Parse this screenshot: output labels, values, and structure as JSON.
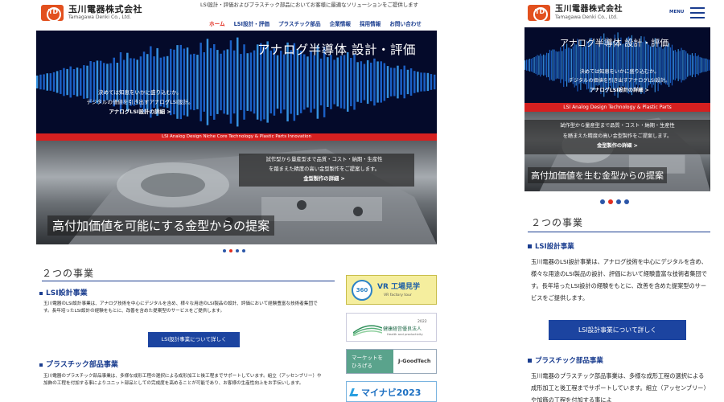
{
  "brand": {
    "name_jp": "玉川電器株式会社",
    "name_en": "Tamagawa Denki Co., Ltd.",
    "mark": "TD",
    "color": "#e2501e"
  },
  "desktop": {
    "tagline": "LSI設計・評価およびプラスチック部品においてお客様に最適なソリューションをご提供します",
    "nav": [
      "ホーム",
      "LSI設計・評価",
      "プラスチック部品",
      "企業情報",
      "採用情報",
      "お問い合わせ"
    ],
    "hero": {
      "title": "アナログ半導体 設計・評価",
      "desc_line1": "決めては知恵をいかに盛り込むか。",
      "desc_line2": "デジタルの価値を引き出すアナログLSI設計。",
      "link": "アナログLSI設計の詳細 >",
      "band": "LSI Analog Design Niche Core Technology & Plastic Parts Innovation",
      "mold_line1": "試作型から量産型まで品質・コスト・納期・生産性",
      "mold_line2": "を踏まえた精度の高い金型製作をご提案します。",
      "mold_link": "金型製作の詳細 >",
      "mold_title": "高付加価値を可能にする金型からの提案"
    },
    "section_title": "２つの事業",
    "lsi": {
      "heading": "LSI設計事業",
      "text": "玉川電器のLSI設計事業は、アナログ技術を中心にデジタルを含め、様々な用途のLSI製品の設計、評価において経験豊富な技術者集団です。長年培ったLSI設計の経験をもとに、改善を含めた提案型のサービスをご提供します。",
      "button": "LSI設計事業について詳しく"
    },
    "plastic": {
      "heading": "プラスチック部品事業",
      "text": "玉川電器のプラスチック部品事業は、多様な成形工程の選択による成形加工と後工程までサポートしています。組立（アッセンブリー）や加飾の工程を付加する事によりユニット部品としての完成度を高めることが可能であり、お客様の生産性向上をお手伝いします。"
    },
    "banners": {
      "vr_badge": "360",
      "vr_title": "VR 工場見学",
      "vr_sub": "VR factory tour",
      "kenko_year": "2022",
      "kenko_title": "健康経営優良法人",
      "kenko_sub": "Health and productivity",
      "good_left_1": "マーケットを",
      "good_left_2": "ひろげる",
      "good_right": "J-GoodTech",
      "navi": "マイナビ2023"
    }
  },
  "mobile": {
    "menu_label": "MENU",
    "hero": {
      "title": "アナログ半導体 設計・評価",
      "desc_line1": "決めては知恵をいかに盛り込むか。",
      "desc_line2": "デジタルの価値を引き出すアナログLSI設計。",
      "link": "アナログLSI設計の詳細 >",
      "band": "LSI Analog Design Technology & Plastic Parts",
      "mold_line1": "試作型から量産型まで品質・コスト・納期・生産性",
      "mold_line2": "を踏まえた精度の高い金型製作をご提案します。",
      "mold_link": "金型製作の詳細 >",
      "mold_title": "高付加価値を生む金型からの提案"
    },
    "section_title": "２つの事業",
    "lsi": {
      "heading": "LSI設計事業",
      "text": "玉川電器のLSI設計事業は、アナログ技術を中心にデジタルを含め、様々な用途のLSI製品の設計、評価において経験豊富な技術者集団です。長年培ったLSI設計の経験をもとに、改善を含めた提案型のサービスをご提供します。",
      "button": "LSI設計事業について詳しく"
    },
    "plastic": {
      "heading": "プラスチック部品事業",
      "text": "玉川電器のプラスチック部品事業は、多様な成形工程の選択による成形加工と後工程までサポートしています。組立（アッセンブリー）や加飾の工程を付加する事によ"
    }
  },
  "slider": {
    "count": 4,
    "active_index": 1
  },
  "colors": {
    "nav": "#1a3d8f",
    "active": "#e22d1f",
    "button": "#1c44a0",
    "band": "#d52020"
  }
}
